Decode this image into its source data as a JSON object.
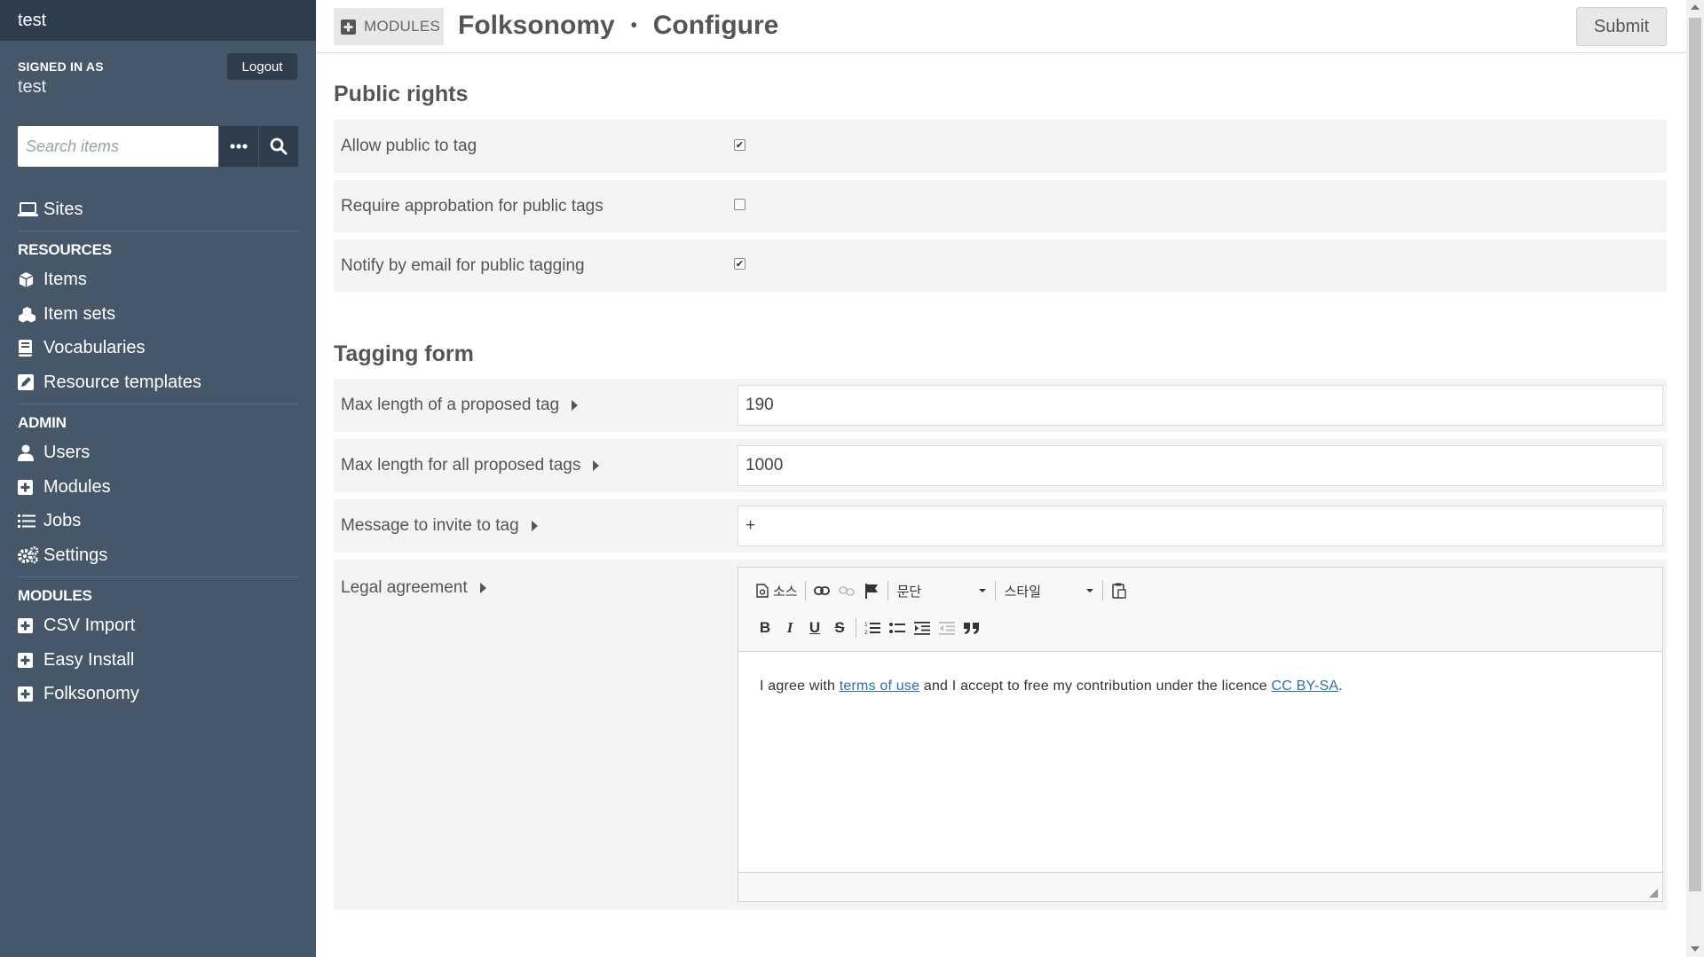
{
  "sidebar": {
    "site_name": "test",
    "signed_in_label": "SIGNED IN AS",
    "user_name": "test",
    "logout_label": "Logout",
    "search": {
      "placeholder": "Search items",
      "value": ""
    },
    "top_items": [
      {
        "label": "Sites",
        "icon": "laptop-icon"
      }
    ],
    "groups": [
      {
        "heading": "RESOURCES",
        "items": [
          {
            "label": "Items",
            "icon": "cube-icon"
          },
          {
            "label": "Item sets",
            "icon": "cubes-icon"
          },
          {
            "label": "Vocabularies",
            "icon": "book-icon"
          },
          {
            "label": "Resource templates",
            "icon": "edit-icon"
          }
        ]
      },
      {
        "heading": "ADMIN",
        "items": [
          {
            "label": "Users",
            "icon": "user-icon"
          },
          {
            "label": "Modules",
            "icon": "plus-square-icon"
          },
          {
            "label": "Jobs",
            "icon": "tasks-icon"
          },
          {
            "label": "Settings",
            "icon": "cogs-icon"
          }
        ]
      },
      {
        "heading": "MODULES",
        "items": [
          {
            "label": "CSV Import",
            "icon": "plus-square-icon"
          },
          {
            "label": "Easy Install",
            "icon": "plus-square-icon"
          },
          {
            "label": "Folksonomy",
            "icon": "plus-square-icon"
          }
        ]
      }
    ]
  },
  "header": {
    "breadcrumb_label": "MODULES",
    "title": "Folksonomy",
    "subtitle": "Configure",
    "submit_label": "Submit"
  },
  "public_rights": {
    "title": "Public rights",
    "fields": [
      {
        "label": "Allow public to tag",
        "checked": true
      },
      {
        "label": "Require approbation for public tags",
        "checked": false
      },
      {
        "label": "Notify by email for public tagging",
        "checked": true
      }
    ]
  },
  "tagging_form": {
    "title": "Tagging form",
    "fields": [
      {
        "label": "Max length of a proposed tag",
        "value": "190"
      },
      {
        "label": "Max length for all proposed tags",
        "value": "1000"
      },
      {
        "label": "Message to invite to tag",
        "value": "+"
      }
    ],
    "legal": {
      "label": "Legal agreement",
      "toolbar": {
        "source_label": "소스",
        "format_label": "문단",
        "style_label": "스타일",
        "bold": "B",
        "italic": "I",
        "underline": "U",
        "strike": "S"
      },
      "content": {
        "part1": "I agree with ",
        "link1": "terms of use",
        "part2": " and I accept to free my contribution under the licence ",
        "link2": "CC BY-SA",
        "part3": "."
      }
    }
  }
}
